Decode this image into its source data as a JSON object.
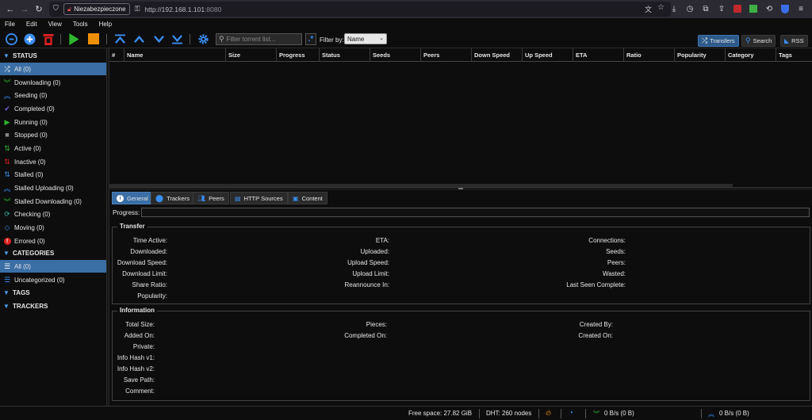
{
  "browser": {
    "security_label": "Niezabezpieczone",
    "url_host": "http://192.168.1.101",
    "url_port": ":8080"
  },
  "menu": [
    "File",
    "Edit",
    "View",
    "Tools",
    "Help"
  ],
  "toolbar": {
    "search_placeholder": "Filter torrent list...",
    "regex_symbol": ".*",
    "filter_by_label": "Filter by:",
    "filter_by_value": "Name",
    "view_buttons": [
      "Transfers",
      "Search",
      "RSS"
    ]
  },
  "sidebar": {
    "status_header": "STATUS",
    "status_items": [
      "All (0)",
      "Downloading (0)",
      "Seeding (0)",
      "Completed (0)",
      "Running (0)",
      "Stopped (0)",
      "Active (0)",
      "Inactive (0)",
      "Stalled (0)",
      "Stalled Uploading (0)",
      "Stalled Downloading (0)",
      "Checking (0)",
      "Moving (0)",
      "Errored (0)"
    ],
    "categories_header": "CATEGORIES",
    "category_items": [
      "All (0)",
      "Uncategorized (0)"
    ],
    "tags_header": "TAGS",
    "trackers_header": "TRACKERS"
  },
  "table": {
    "columns": [
      "#",
      "Name",
      "Size",
      "Progress",
      "Status",
      "Seeds",
      "Peers",
      "Down Speed",
      "Up Speed",
      "ETA",
      "Ratio",
      "Popularity",
      "Category",
      "Tags"
    ]
  },
  "props": {
    "tabs": [
      "General",
      "Trackers",
      "Peers",
      "HTTP Sources",
      "Content"
    ],
    "progress_label": "Progress:",
    "progress_value": 0,
    "transfer_legend": "Transfer",
    "transfer_col1": [
      "Time Active:",
      "Downloaded:",
      "Download Speed:",
      "Download Limit:",
      "Share Ratio:",
      "Popularity:"
    ],
    "transfer_col2": [
      "ETA:",
      "Uploaded:",
      "Upload Speed:",
      "Upload Limit:",
      "Reannounce In:"
    ],
    "transfer_col3": [
      "Connections:",
      "Seeds:",
      "Peers:",
      "Wasted:",
      "Last Seen Complete:"
    ],
    "info_legend": "Information",
    "info_col1": [
      "Total Size:",
      "Added On:",
      "Private:",
      "Info Hash v1:",
      "Info Hash v2:",
      "Save Path:",
      "Comment:"
    ],
    "info_col2": [
      "Pieces:",
      "Completed On:"
    ],
    "info_col3": [
      "Created By:",
      "Created On:"
    ]
  },
  "status": {
    "free_space": "Free space: 27.82 GiB",
    "dht": "DHT: 260 nodes",
    "down": "0 B/s (0 B)",
    "up": "0 B/s (0 B)"
  },
  "colors": {
    "accent": "#3a6ea5",
    "icon_blue": "#3a8df0",
    "green": "#2eb82e",
    "orange": "#f0900a",
    "red": "#e02020"
  }
}
